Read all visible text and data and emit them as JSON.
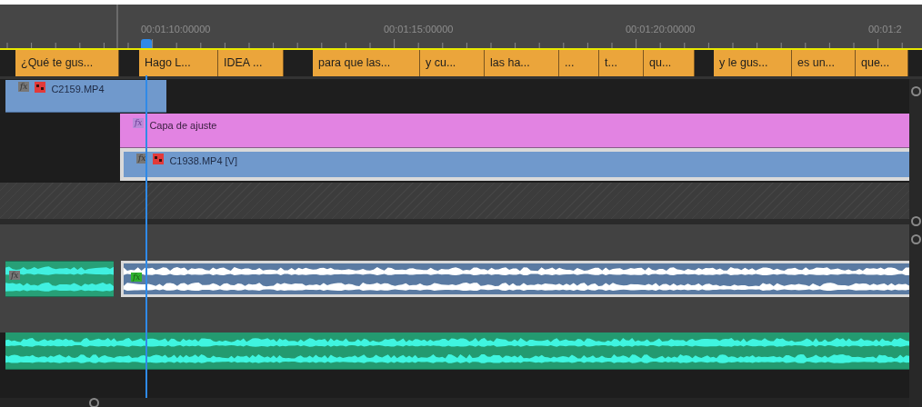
{
  "ruler": {
    "timecodes": [
      "00:01:10:00000",
      "00:01:15:00000",
      "00:01:20:00000",
      "00:01:2"
    ]
  },
  "captions": [
    {
      "text": "¿Qué te gus..."
    },
    {
      "text": "Hago L..."
    },
    {
      "text": "IDEA ..."
    },
    {
      "text": "para que las..."
    },
    {
      "text": "y cu..."
    },
    {
      "text": "las ha..."
    },
    {
      "text": "..."
    },
    {
      "text": "t..."
    },
    {
      "text": "qu..."
    },
    {
      "text": "y le gus..."
    },
    {
      "text": "es un..."
    },
    {
      "text": "que..."
    }
  ],
  "video_tracks": [
    {
      "clips": [
        {
          "kind": "video",
          "name": "C2159.MP4",
          "badge": "fx"
        }
      ]
    },
    {
      "clips": [
        {
          "kind": "adjustment",
          "name": "Capa de ajuste",
          "badge": "fx"
        }
      ]
    },
    {
      "clips": [
        {
          "kind": "video",
          "name": "C1938.MP4 [V]",
          "badge": "fx",
          "selected": true
        }
      ]
    }
  ],
  "audio_tracks": [
    {
      "clips": [
        {
          "kind": "audio-green",
          "badge": "fx"
        },
        {
          "kind": "audio-linked",
          "badge": "fx"
        }
      ]
    },
    {
      "clips": [
        {
          "kind": "audio-cyan"
        }
      ]
    }
  ]
}
